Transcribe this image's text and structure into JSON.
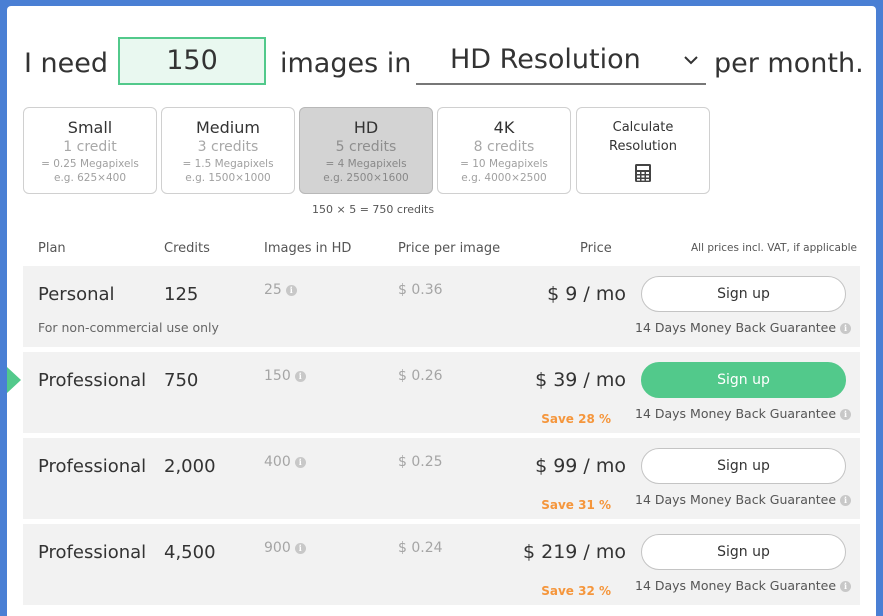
{
  "headline": {
    "prefix": "I need",
    "count_value": "150",
    "middle": "images in",
    "resolution_selected": "HD Resolution",
    "suffix": "per month."
  },
  "sizes": [
    {
      "name": "Small",
      "credits": "1 credit",
      "megapixels": "= 0.25 Megapixels",
      "example": "e.g. 625×400",
      "active": false
    },
    {
      "name": "Medium",
      "credits": "3 credits",
      "megapixels": "= 1.5 Megapixels",
      "example": "e.g. 1500×1000",
      "active": false
    },
    {
      "name": "HD",
      "credits": "5 credits",
      "megapixels": "= 4 Megapixels",
      "example": "e.g. 2500×1600",
      "active": true
    },
    {
      "name": "4K",
      "credits": "8 credits",
      "megapixels": "= 10 Megapixels",
      "example": "e.g. 4000×2500",
      "active": false
    }
  ],
  "calculate": {
    "line1": "Calculate",
    "line2": "Resolution",
    "icon": "calculator-icon"
  },
  "formula": "150 × 5 = 750 credits",
  "table_header": {
    "plan": "Plan",
    "credits": "Credits",
    "images": "Images in HD",
    "price_per_image": "Price per image",
    "price": "Price",
    "vat_note": "All prices incl. VAT, if applicable"
  },
  "plans": [
    {
      "name": "Personal",
      "credits": "125",
      "images": "25",
      "price_per_image": "$ 0.36",
      "price": "$ 9 / mo",
      "save": "",
      "note": "For non-commercial use only",
      "button": "Sign up",
      "highlighted": false,
      "guarantee": "14 Days Money Back Guarantee"
    },
    {
      "name": "Professional",
      "credits": "750",
      "images": "150",
      "price_per_image": "$ 0.26",
      "price": "$ 39 / mo",
      "save": "Save 28 %",
      "note": "",
      "button": "Sign up",
      "highlighted": true,
      "guarantee": "14 Days Money Back Guarantee"
    },
    {
      "name": "Professional",
      "credits": "2,000",
      "images": "400",
      "price_per_image": "$ 0.25",
      "price": "$ 99 / mo",
      "save": "Save 31 %",
      "note": "",
      "button": "Sign up",
      "highlighted": false,
      "guarantee": "14 Days Money Back Guarantee"
    },
    {
      "name": "Professional",
      "credits": "4,500",
      "images": "900",
      "price_per_image": "$ 0.24",
      "price": "$ 219 / mo",
      "save": "Save 32 %",
      "note": "",
      "button": "Sign up",
      "highlighted": false,
      "guarantee": "14 Days Money Back Guarantee"
    }
  ],
  "colors": {
    "accent": "#52c98b",
    "save": "#f5963c",
    "background": "#4a7fd4"
  }
}
